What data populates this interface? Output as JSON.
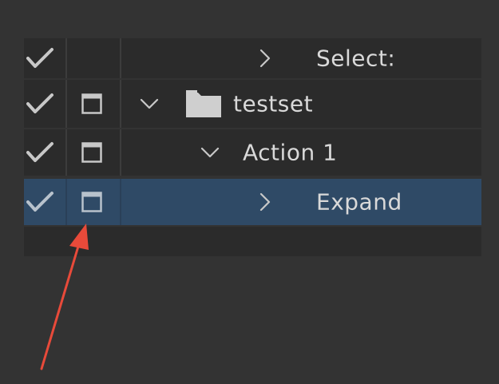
{
  "actions_panel": {
    "rows": [
      {
        "label": "Select:",
        "checked": true,
        "has_dialog_box": false,
        "expanded": false,
        "selected": false,
        "type": "command"
      },
      {
        "label": "testset",
        "checked": true,
        "has_dialog_box": true,
        "expanded": true,
        "selected": false,
        "type": "set"
      },
      {
        "label": "Action 1",
        "checked": true,
        "has_dialog_box": true,
        "expanded": true,
        "selected": false,
        "type": "action"
      },
      {
        "label": "Expand",
        "checked": true,
        "has_dialog_box": true,
        "expanded": false,
        "selected": true,
        "type": "command"
      }
    ]
  },
  "icons": {
    "toggle": "checkmark-icon",
    "dialog": "dialog-toggle-box-icon",
    "collapsed": "chevron-right-icon",
    "expanded": "chevron-down-icon",
    "set": "folder-icon",
    "annotation": "red-arrow"
  },
  "colors": {
    "background": "#333333",
    "row": "#2b2b2b",
    "selected_row": "#2f4a66",
    "text": "#d9d9d9",
    "icon": "#c8c8c8",
    "annotation_arrow": "#e84a3a"
  }
}
